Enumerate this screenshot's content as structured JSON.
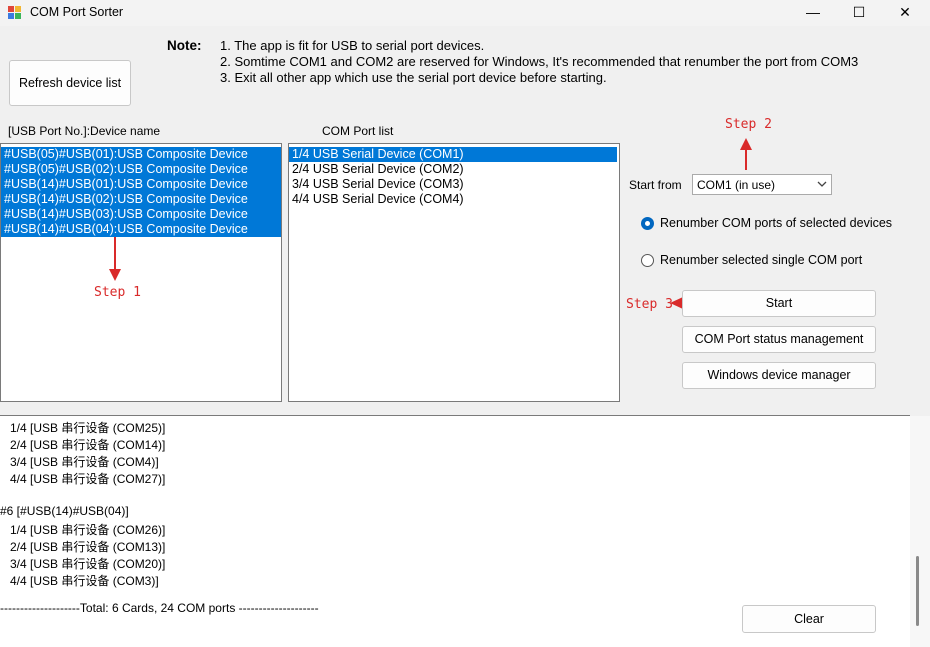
{
  "window": {
    "title": "COM Port Sorter",
    "minimize_glyph": "—",
    "maximize_glyph": "☐",
    "close_glyph": "✕"
  },
  "note": {
    "label": "Note:",
    "lines": [
      "1. The app is fit for USB to serial port devices.",
      "2. Somtime COM1 and COM2 are reserved for Windows, It's recommended that renumber the port from COM3",
      "3. Exit all other app which use the serial port device before starting."
    ]
  },
  "refresh_button": "Refresh device list",
  "device_list": {
    "header": "[USB Port No.]:Device name",
    "items": [
      "#USB(05)#USB(01):USB Composite Device",
      "#USB(05)#USB(02):USB Composite Device",
      "#USB(14)#USB(01):USB Composite Device",
      "#USB(14)#USB(02):USB Composite Device",
      "#USB(14)#USB(03):USB Composite Device",
      "#USB(14)#USB(04):USB Composite Device"
    ]
  },
  "com_list": {
    "header": "COM Port list",
    "items": [
      "1/4 USB Serial Device (COM1)",
      "2/4 USB Serial Device (COM2)",
      "3/4 USB Serial Device (COM3)",
      "4/4 USB Serial Device (COM4)"
    ]
  },
  "steps": {
    "step1": "Step 1",
    "step2": "Step 2",
    "step3": "Step 3"
  },
  "start_from": {
    "label": "Start from",
    "selected": "COM1 (in use)"
  },
  "radios": {
    "option1": "Renumber COM ports of selected devices",
    "option2": "Renumber selected single COM port",
    "selected": "option1"
  },
  "buttons": {
    "start": "Start",
    "status_mgmt": "COM Port status management",
    "device_manager": "Windows device manager",
    "clear": "Clear"
  },
  "log": {
    "lines": [
      "   1/4 [USB 串行设备 (COM25)]",
      "   2/4 [USB 串行设备 (COM14)]",
      "   3/4 [USB 串行设备 (COM4)]",
      "   4/4 [USB 串行设备 (COM27)]",
      "",
      "#6 [#USB(14)#USB(04)]",
      "   1/4 [USB 串行设备 (COM26)]",
      "   2/4 [USB 串行设备 (COM13)]",
      "   3/4 [USB 串行设备 (COM20)]",
      "   4/4 [USB 串行设备 (COM3)]",
      "",
      "--------------------Total: 6 Cards, 24 COM ports --------------------"
    ]
  },
  "colors": {
    "selection": "#0078d7",
    "annotation": "#d92a2a",
    "radio_selected": "#0067c0"
  }
}
